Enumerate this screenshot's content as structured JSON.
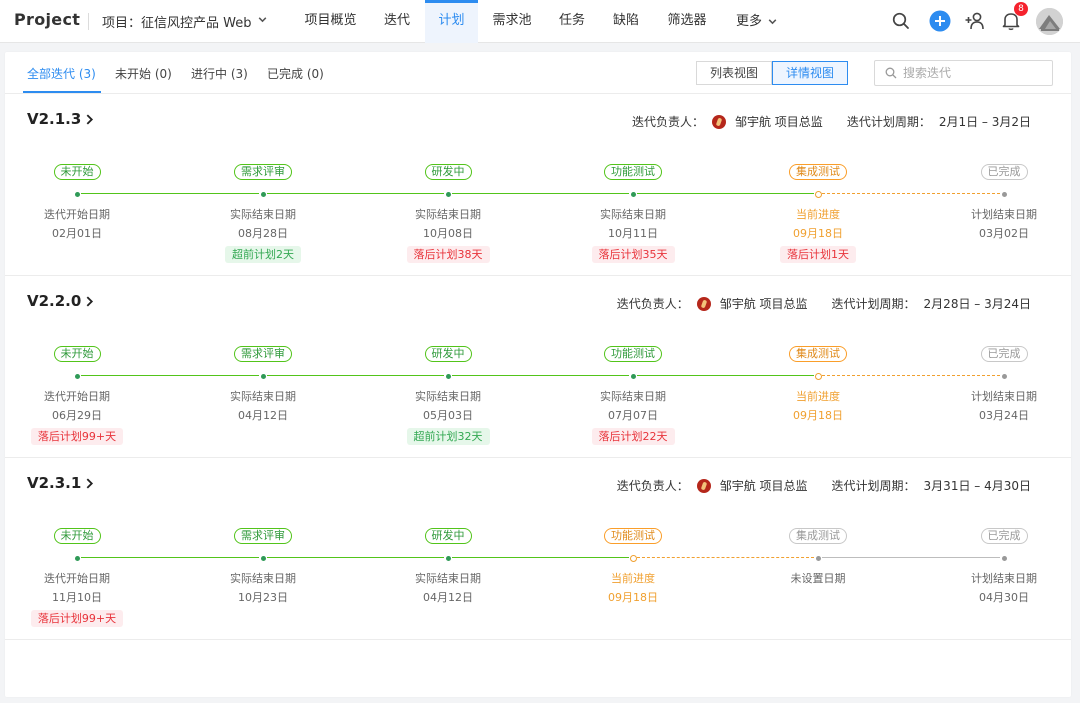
{
  "app_title": "Project",
  "project_selector": "项目：征信风控产品 Web",
  "nav": [
    {
      "label": "项目概览"
    },
    {
      "label": "迭代"
    },
    {
      "label": "计划"
    },
    {
      "label": "需求池"
    },
    {
      "label": "任务"
    },
    {
      "label": "缺陷"
    },
    {
      "label": "筛选器"
    },
    {
      "label": "更多"
    }
  ],
  "notification_count": "8",
  "colors": {
    "accent": "#2d8cf0",
    "done_green": "#52c41a",
    "current_orange": "#fa9e2a",
    "late_red": "#e8333a"
  },
  "filter_tabs": [
    {
      "label": "全部迭代 (3)",
      "active": true
    },
    {
      "label": "未开始 (0)"
    },
    {
      "label": "进行中 (3)"
    },
    {
      "label": "已完成 (0)"
    }
  ],
  "views": {
    "list": "列表视图",
    "detail": "详情视图"
  },
  "search": {
    "placeholder": "搜索迭代"
  },
  "owner_label": "迭代负责人：",
  "period_label": "迭代计划周期：",
  "iterations": [
    {
      "name": "V2.1.3",
      "owner": "邹宇航 项目总监",
      "period": "2月1日 – 3月2日",
      "stages": [
        {
          "pill": "未开始",
          "label": "迭代开始日期",
          "date": "02月01日",
          "tag": ""
        },
        {
          "pill": "需求评审",
          "label": "实际结束日期",
          "date": "08月28日",
          "tag": "超前计划2天"
        },
        {
          "pill": "研发中",
          "label": "实际结束日期",
          "date": "10月08日",
          "tag": "落后计划38天"
        },
        {
          "pill": "功能测试",
          "label": "实际结束日期",
          "date": "10月11日",
          "tag": "落后计划35天"
        },
        {
          "pill": "集成测试",
          "label": "当前进度",
          "date": "09月18日",
          "tag": "落后计划1天"
        },
        {
          "pill": "已完成",
          "label": "计划结束日期",
          "date": "03月02日",
          "tag": ""
        }
      ]
    },
    {
      "name": "V2.2.0",
      "owner": "邹宇航 项目总监",
      "period": "2月28日 – 3月24日",
      "stages": [
        {
          "pill": "未开始",
          "label": "迭代开始日期",
          "date": "06月29日",
          "tag": "落后计划99+天"
        },
        {
          "pill": "需求评审",
          "label": "实际结束日期",
          "date": "04月12日",
          "tag": ""
        },
        {
          "pill": "研发中",
          "label": "实际结束日期",
          "date": "05月03日",
          "tag": "超前计划32天"
        },
        {
          "pill": "功能测试",
          "label": "实际结束日期",
          "date": "07月07日",
          "tag": "落后计划22天"
        },
        {
          "pill": "集成测试",
          "label": "当前进度",
          "date": "09月18日",
          "tag": ""
        },
        {
          "pill": "已完成",
          "label": "计划结束日期",
          "date": "03月24日",
          "tag": ""
        }
      ]
    },
    {
      "name": "V2.3.1",
      "owner": "邹宇航 项目总监",
      "period": "3月31日 – 4月30日",
      "stages": [
        {
          "pill": "未开始",
          "label": "迭代开始日期",
          "date": "11月10日",
          "tag": "落后计划99+天"
        },
        {
          "pill": "需求评审",
          "label": "实际结束日期",
          "date": "10月23日",
          "tag": ""
        },
        {
          "pill": "研发中",
          "label": "实际结束日期",
          "date": "04月12日",
          "tag": ""
        },
        {
          "pill": "功能测试",
          "label": "当前进度",
          "date": "09月18日",
          "tag": ""
        },
        {
          "pill": "集成测试",
          "label": "未设置日期",
          "date": "",
          "tag": ""
        },
        {
          "pill": "已完成",
          "label": "计划结束日期",
          "date": "04月30日",
          "tag": ""
        }
      ]
    }
  ]
}
